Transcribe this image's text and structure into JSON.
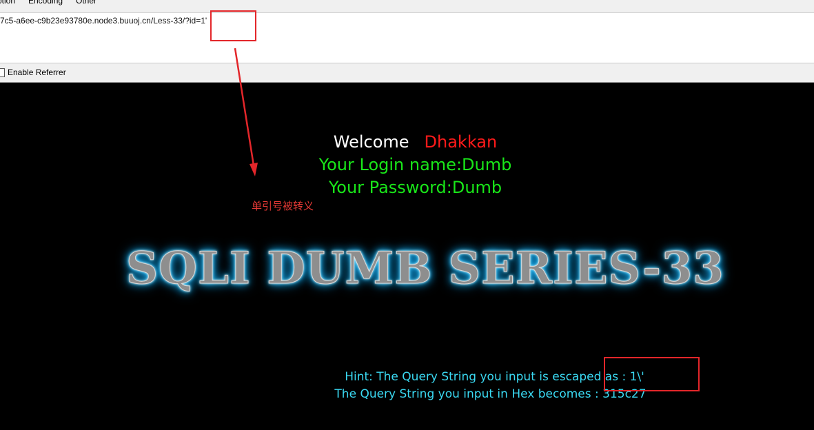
{
  "menu": {
    "option": "otion",
    "encoding": "Encoding",
    "other": "Other"
  },
  "address": {
    "url": "7c5-a6ee-c9b23e93780e.node3.buuoj.cn/Less-33/?id=1'"
  },
  "options": {
    "enable_referrer": "Enable Referrer"
  },
  "page": {
    "welcome": "Welcome",
    "username": "Dhakkan",
    "login_name": "Your Login name:Dumb",
    "password": "Your Password:Dumb",
    "banner": "SQLI DUMB SERIES-33",
    "hint_line1": "Hint: The Query String you input is escaped as : 1\\'",
    "hint_line2": "The Query String you input in Hex becomes : 315c27"
  },
  "annotation": {
    "text": "单引号被转义",
    "color": "#e53935"
  }
}
